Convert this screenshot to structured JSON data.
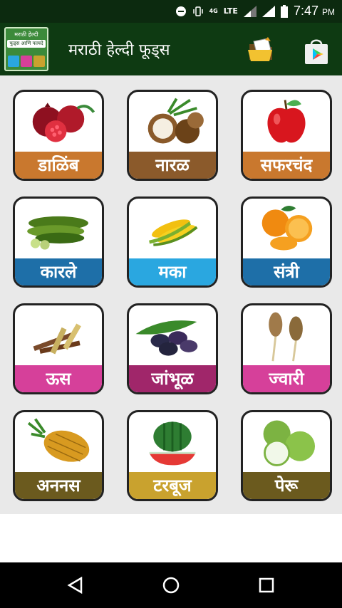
{
  "status_bar": {
    "time": "7:47",
    "ampm": "PM",
    "network": "4G",
    "lte": "LTE"
  },
  "app_bar": {
    "title": "मराठी हेल्दी फूड्स",
    "logo_line1": "मराठी हेल्दी",
    "logo_line2": "फूड्स आणि फायदे"
  },
  "foods": [
    {
      "label": "डाळिंब",
      "color": "#c9782e"
    },
    {
      "label": "नारळ",
      "color": "#8b5a2b"
    },
    {
      "label": "सफरचंद",
      "color": "#c9782e"
    },
    {
      "label": "कारले",
      "color": "#1e6fa8"
    },
    {
      "label": "मका",
      "color": "#2aa7e0"
    },
    {
      "label": "संत्री",
      "color": "#1e6fa8"
    },
    {
      "label": "ऊस",
      "color": "#d6409a"
    },
    {
      "label": "जांभूळ",
      "color": "#a0266a"
    },
    {
      "label": "ज्वारी",
      "color": "#d6409a"
    },
    {
      "label": "अननस",
      "color": "#6b5a1e"
    },
    {
      "label": "टरबूज",
      "color": "#c9a22e"
    },
    {
      "label": "पेरू",
      "color": "#6b5a1e"
    }
  ]
}
